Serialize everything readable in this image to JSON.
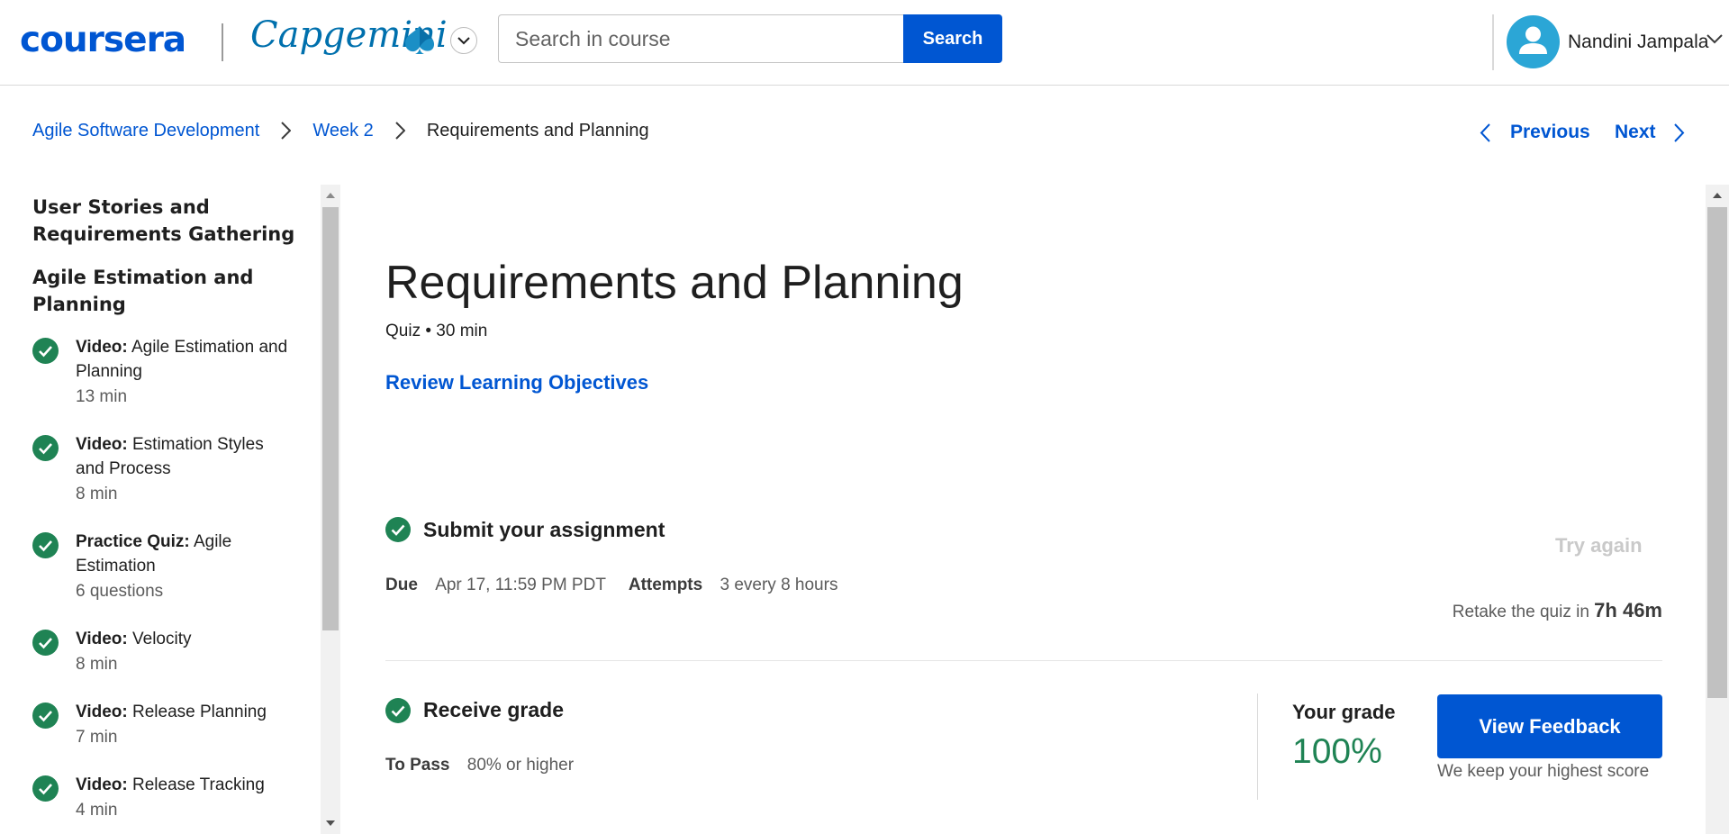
{
  "header": {
    "logo_text": "coursera",
    "partner_logo_text": "Capgemini",
    "partner_switcher_icon": "chevron-down-icon",
    "search": {
      "placeholder": "Search in course",
      "value": "",
      "button_label": "Search"
    },
    "user": {
      "name": "Nandini Jampala",
      "avatar_icon": "user-avatar-icon",
      "menu_icon": "chevron-down-icon"
    }
  },
  "breadcrumb": {
    "items": [
      "Agile Software Development",
      "Week 2",
      "Requirements and Planning"
    ],
    "separator_icon": "chevron-right-icon"
  },
  "navigation": {
    "previous_label": "Previous",
    "next_label": "Next"
  },
  "sidebar": {
    "sections": [
      "User Stories and Requirements Gathering",
      "Agile Estimation and Planning"
    ],
    "items": [
      {
        "type": "Video:",
        "title": "Agile Estimation and Planning",
        "duration": "13 min",
        "status": "completed"
      },
      {
        "type": "Video:",
        "title": "Estimation Styles and Process",
        "duration": "8 min",
        "status": "completed"
      },
      {
        "type": "Practice Quiz:",
        "title": "Agile Estimation",
        "duration": "6 questions",
        "status": "completed"
      },
      {
        "type": "Video:",
        "title": "Velocity",
        "duration": "8 min",
        "status": "completed"
      },
      {
        "type": "Video:",
        "title": "Release Planning",
        "duration": "7 min",
        "status": "completed"
      },
      {
        "type": "Video:",
        "title": "Release Tracking",
        "duration": "4 min",
        "status": "completed"
      }
    ]
  },
  "main": {
    "title": "Requirements and Planning",
    "meta": "Quiz • 30 min",
    "review_link": "Review Learning Objectives",
    "submit": {
      "title": "Submit your assignment",
      "due_label": "Due",
      "due_value": "Apr 17, 11:59 PM PDT",
      "attempts_label": "Attempts",
      "attempts_value": "3 every 8 hours",
      "try_again_label": "Try again",
      "retake_text": "Retake the quiz in",
      "retake_time": "7h 46m"
    },
    "grade": {
      "title": "Receive grade",
      "to_pass_label": "To Pass",
      "to_pass_value": "80% or higher",
      "your_grade_label": "Your grade",
      "your_grade_value": "100%",
      "feedback_button": "View Feedback",
      "note": "We keep your highest score"
    }
  },
  "colors": {
    "brand_blue": "#0056d2",
    "success_green": "#1f8354",
    "avatar_blue": "#2ba6d6",
    "disabled_text": "#c9c9c9"
  }
}
